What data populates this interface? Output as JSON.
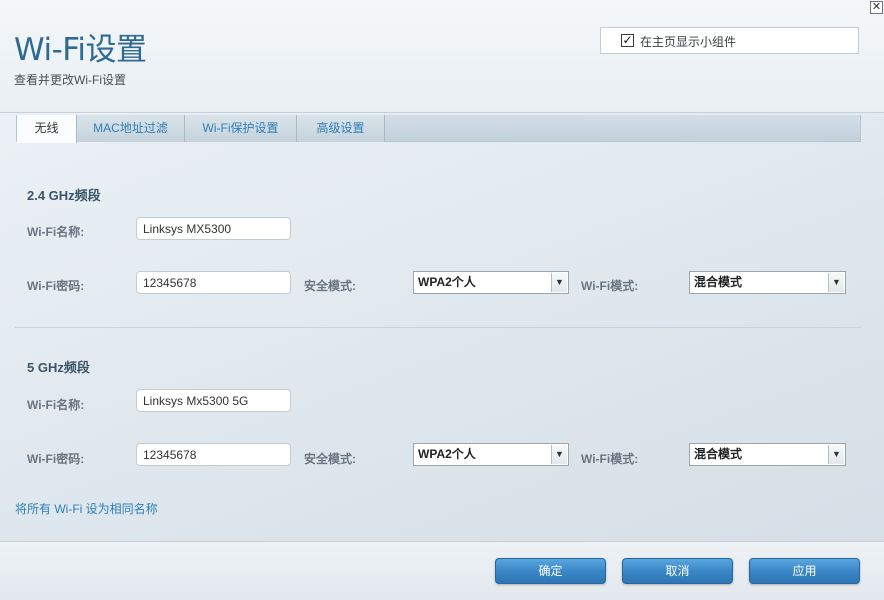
{
  "header": {
    "title": "Wi-Fi设置",
    "subtitle": "查看并更改Wi-Fi设置",
    "widget_checkbox_checked": true,
    "widget_checkbox_label": "在主页显示小组件",
    "close_glyph": "✕"
  },
  "tabs": [
    {
      "label": "无线",
      "active": true
    },
    {
      "label": "MAC地址过滤",
      "active": false
    },
    {
      "label": "Wi-Fi保护设置",
      "active": false
    },
    {
      "label": "高级设置",
      "active": false
    }
  ],
  "band24": {
    "title": "2.4 GHz频段",
    "name_label": "Wi-Fi名称:",
    "name_value": "Linksys MX5300",
    "password_label": "Wi-Fi密码:",
    "password_value": "12345678",
    "security_label": "安全模式:",
    "security_value": "WPA2个人",
    "mode_label": "Wi-Fi模式:",
    "mode_value": "混合模式"
  },
  "band5": {
    "title": "5 GHz频段",
    "name_label": "Wi-Fi名称:",
    "name_value": "Linksys Mx5300 5G",
    "password_label": "Wi-Fi密码:",
    "password_value": "12345678",
    "security_label": "安全模式:",
    "security_value": "WPA2个人",
    "mode_label": "Wi-Fi模式:",
    "mode_value": "混合模式"
  },
  "same_name_link": "将所有 Wi-Fi 设为相同名称",
  "footer": {
    "ok_label": "确定",
    "cancel_label": "取消",
    "apply_label": "应用"
  },
  "colors": {
    "accent": "#2f6a95",
    "link": "#2d7fb8",
    "button": "#3a87c7"
  },
  "icons": {
    "close": "close-icon",
    "check": "checkmark-icon",
    "dropdown": "chevron-down-icon"
  }
}
